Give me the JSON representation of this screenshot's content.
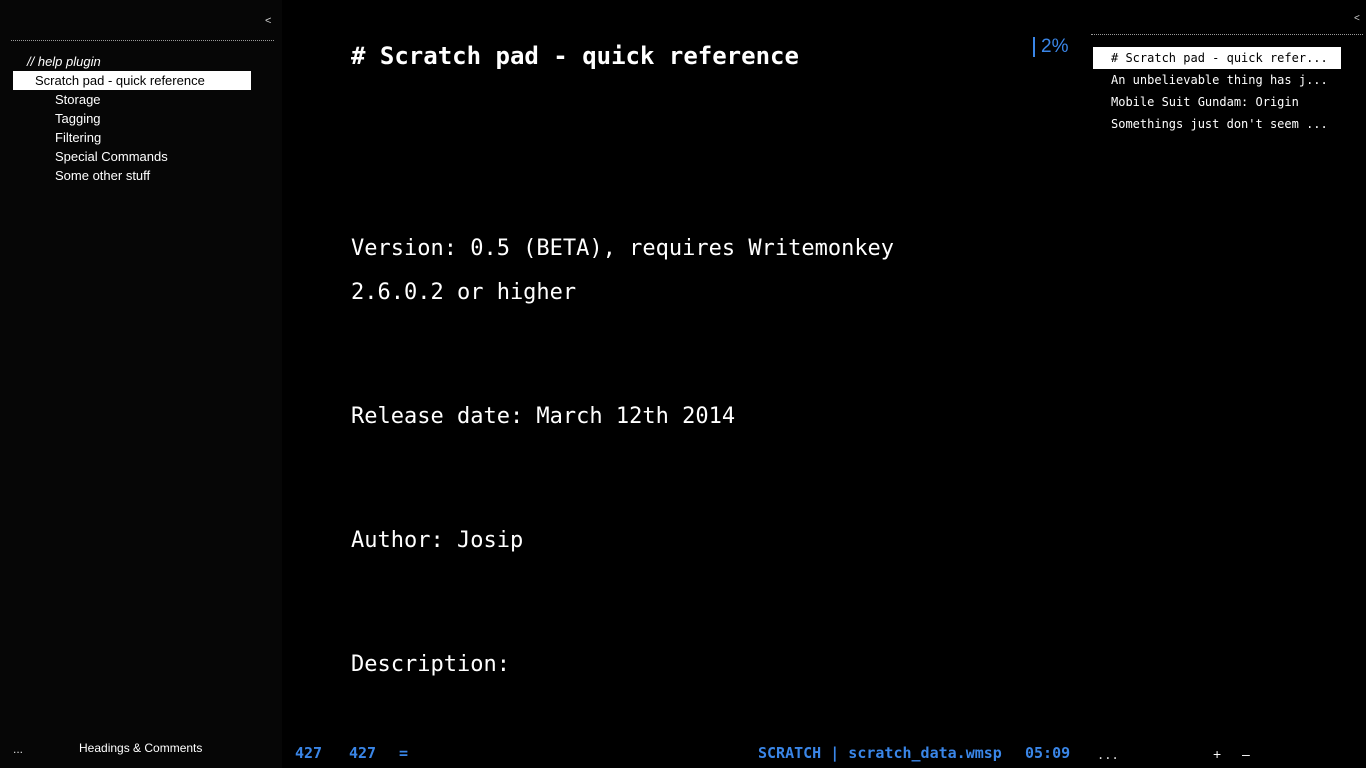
{
  "colors": {
    "background": "#000000",
    "panel_background": "#060606",
    "accent": "#3a86e8",
    "text": "#ffffff",
    "selection_background": "#ffffff",
    "selection_text": "#000000"
  },
  "left_panel": {
    "collapse_glyph": "<",
    "outline": [
      {
        "label": "// help plugin",
        "level": 0,
        "selected": false
      },
      {
        "label": "Scratch pad - quick reference",
        "level": 1,
        "selected": true
      },
      {
        "label": "Storage",
        "level": 2,
        "selected": false
      },
      {
        "label": "Tagging",
        "level": 2,
        "selected": false
      },
      {
        "label": "Filtering",
        "level": 2,
        "selected": false
      },
      {
        "label": "Special Commands",
        "level": 2,
        "selected": false
      },
      {
        "label": "Some other stuff",
        "level": 2,
        "selected": false
      }
    ],
    "footer": {
      "menu_label": "...",
      "mode_label": "Headings & Comments"
    }
  },
  "editor": {
    "heading": "# Scratch pad - quick reference",
    "paragraphs": {
      "version": "Version: 0.5 (BETA), requires Writemonkey 2.6.0.2 or higher",
      "release": "Release date: March 12th 2014",
      "author": "Author: Josip",
      "description": "Description:"
    },
    "progress": "2%"
  },
  "right_panel": {
    "collapse_glyph": "<",
    "files": [
      {
        "label": "# Scratch pad - quick refer...",
        "selected": true
      },
      {
        "label": "An unbelievable thing has j...",
        "selected": false
      },
      {
        "label": "Mobile Suit Gundam: Origin",
        "selected": false
      },
      {
        "label": "Somethings just don't seem ...",
        "selected": false
      }
    ],
    "footer": {
      "menu_label": "...",
      "add_label": "+",
      "remove_label": "–"
    }
  },
  "status_bar": {
    "words": "427",
    "characters": "427",
    "separator": "=",
    "mode": "SCRATCH | scratch_data.wmsp",
    "time": "05:09"
  }
}
